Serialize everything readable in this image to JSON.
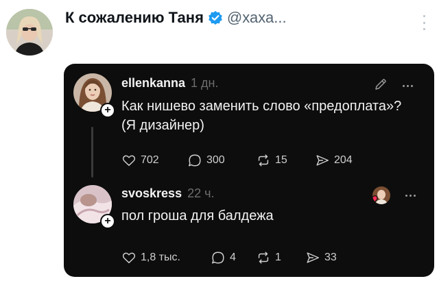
{
  "tweet": {
    "author_name": "К сожалению Таня",
    "handle": "@хаха...",
    "verified": true,
    "colors": {
      "verified_badge": "#1d9bf0",
      "handle": "#536471"
    }
  },
  "embedded_screenshot": {
    "background": "#0d0d0d",
    "posts": [
      {
        "username": "ellenkanna",
        "time": "1 дн.",
        "text_lines": [
          "Как нишево заменить слово «предоплата»?",
          "(Я дизайнер)"
        ],
        "top_right_icons": [
          "edit-pencil-icon",
          "more-dots-icon"
        ],
        "actions": {
          "likes": "702",
          "replies": "300",
          "reposts": "15",
          "shares": "204"
        }
      },
      {
        "username": "svoskress",
        "time": "22 ч.",
        "text_lines": [
          "пол гроша для балдежа"
        ],
        "top_right_icons": [
          "liked-by-author-icon",
          "more-dots-icon"
        ],
        "actions": {
          "likes": "1,8 тыс.",
          "replies": "4",
          "reposts": "1",
          "shares": "33"
        }
      }
    ]
  }
}
